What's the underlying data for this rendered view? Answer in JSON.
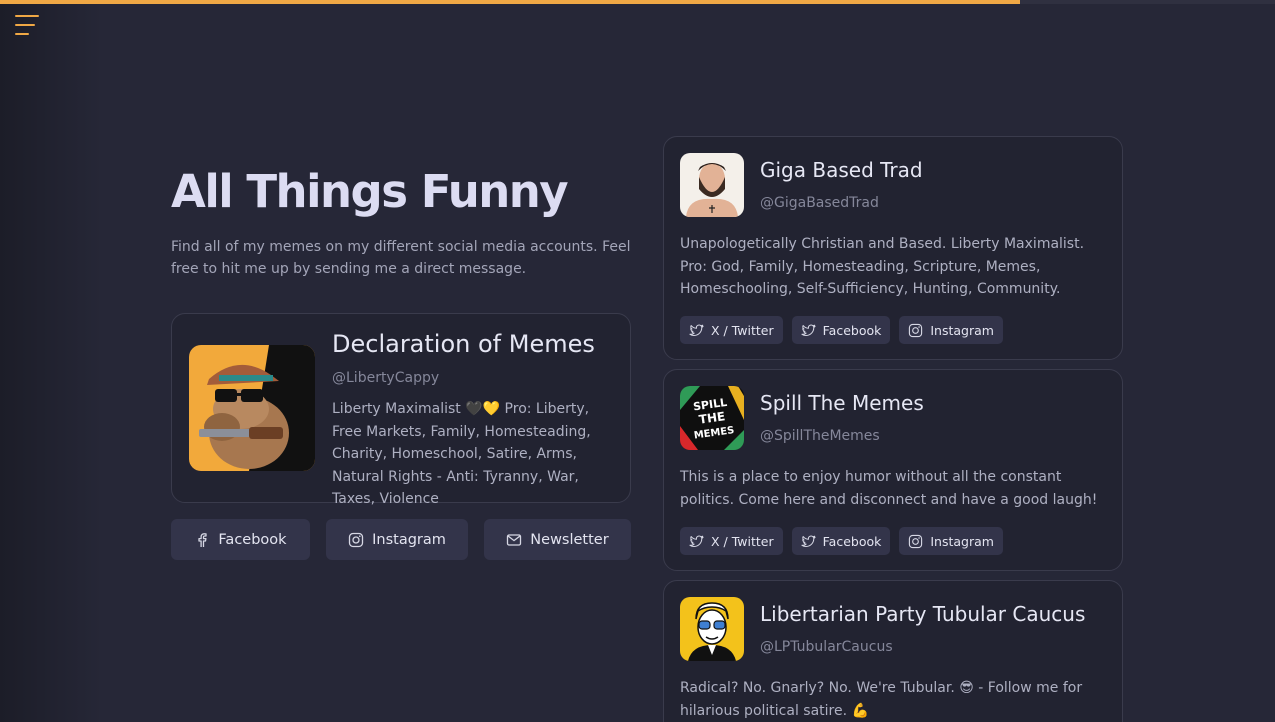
{
  "progress": {
    "fraction": 0.8,
    "color": "#f0a845"
  },
  "hero": {
    "title": "All Things Funny",
    "intro": "Find all of my memes on my different social media accounts. Feel free to hit me up by sending me a direct message."
  },
  "profile": {
    "name": "Declaration of Memes",
    "handle": "@LibertyCappy",
    "bio": "Liberty Maximalist 🖤💛 Pro: Liberty, Free Markets, Family, Homesteading, Charity, Homeschool, Satire, Arms, Natural Rights - Anti: Tyranny, War, Taxes, Violence"
  },
  "links": [
    {
      "label": "Facebook",
      "icon": "facebook-icon"
    },
    {
      "label": "Instagram",
      "icon": "instagram-icon"
    },
    {
      "label": "Newsletter",
      "icon": "mail-icon"
    }
  ],
  "cards": [
    {
      "name": "Giga Based Trad",
      "handle": "@GigaBasedTrad",
      "bio": "Unapologetically Christian and Based. Liberty Maximalist. Pro: God, Family, Homesteading, Scripture, Memes, Homeschooling, Self-Sufficiency, Hunting, Community.",
      "links": [
        "X / Twitter",
        "Facebook",
        "Instagram"
      ]
    },
    {
      "name": "Spill The Memes",
      "handle": "@SpillTheMemes",
      "bio": "This is a place to enjoy humor without all the constant politics. Come here and disconnect and have a good laugh!",
      "links": [
        "X / Twitter",
        "Facebook",
        "Instagram"
      ]
    },
    {
      "name": "Libertarian Party Tubular Caucus",
      "handle": "@LPTubularCaucus",
      "bio": "Radical? No. Gnarly? No. We're Tubular. 😎 - Follow me for hilarious political satire. 💪"
    }
  ]
}
